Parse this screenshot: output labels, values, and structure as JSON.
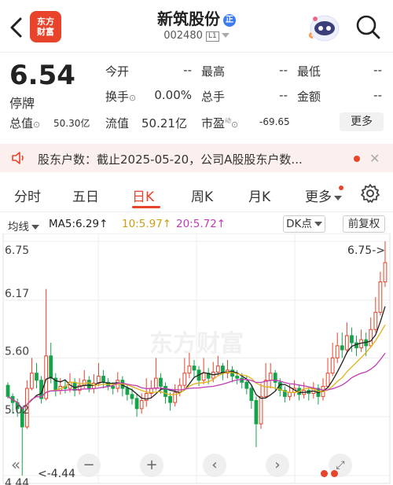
{
  "header": {
    "logo_line1": "东方",
    "logo_line2": "财富",
    "stock_name": "新筑股份",
    "name_badge": "正",
    "stock_code": "002480",
    "level": "L1"
  },
  "quote": {
    "price": "6.54",
    "status": "停牌",
    "rows": [
      {
        "label": "今开",
        "value": "--"
      },
      {
        "label": "最高",
        "value": "--"
      },
      {
        "label": "最低",
        "value": "--"
      },
      {
        "label": "换手",
        "value": "0.00%"
      },
      {
        "label": "总手",
        "value": "--"
      },
      {
        "label": "金额",
        "value": "--"
      }
    ],
    "total_cap_label": "总值",
    "total_cap": "50.30亿",
    "float_cap_label": "流值",
    "float_cap": "50.21亿",
    "pe_label": "市盈",
    "pe_sup": "动",
    "pe_value": "-69.65",
    "more": "更多"
  },
  "notice": {
    "text": "股东户数：截止2025-05-20，公司A股股东户数..."
  },
  "tabs": [
    {
      "label": "分时"
    },
    {
      "label": "五日"
    },
    {
      "label": "日K"
    },
    {
      "label": "周K"
    },
    {
      "label": "月K"
    },
    {
      "label": "更多"
    }
  ],
  "indicator": {
    "label": "均线",
    "ma5": "MA5:6.29",
    "ma10": "10:5.97",
    "ma20": "20:5.72",
    "arrow": "↑",
    "dk": "DK点",
    "adjust": "前复权"
  },
  "colors": {
    "up": "#e8432b",
    "down": "#14a34a",
    "ma5": "#222222",
    "ma10": "#e0b21a",
    "ma20": "#c23bb5"
  },
  "chart_data": {
    "type": "candlestick",
    "y_axis_ticks": [
      "6.75",
      "6.17",
      "5.60",
      "5.02",
      "4.44"
    ],
    "ylim": [
      4.44,
      6.75
    ],
    "max_label": "6.75->",
    "min_label": "<-4.44",
    "watermark": "东方财富",
    "candles": [
      [
        5.33,
        5.22,
        5.36,
        5.2
      ],
      [
        5.22,
        5.16,
        5.25,
        5.05
      ],
      [
        5.16,
        5.1,
        5.2,
        5.02
      ],
      [
        5.1,
        4.92,
        5.12,
        4.44
      ],
      [
        4.92,
        5.3,
        5.38,
        4.9
      ],
      [
        5.3,
        5.45,
        5.6,
        5.28
      ],
      [
        5.45,
        5.38,
        5.55,
        5.3
      ],
      [
        5.38,
        5.2,
        5.42,
        5.15
      ],
      [
        5.2,
        5.62,
        6.28,
        5.18
      ],
      [
        5.62,
        5.4,
        5.75,
        5.35
      ],
      [
        5.4,
        5.28,
        5.45,
        5.22
      ],
      [
        5.28,
        5.32,
        5.4,
        5.24
      ],
      [
        5.32,
        5.3,
        5.38,
        5.25
      ],
      [
        5.3,
        5.36,
        5.45,
        5.26
      ],
      [
        5.36,
        5.28,
        5.4,
        5.22
      ],
      [
        5.28,
        5.33,
        5.4,
        5.24
      ],
      [
        5.33,
        5.38,
        5.48,
        5.3
      ],
      [
        5.38,
        5.3,
        5.42,
        5.26
      ],
      [
        5.3,
        5.35,
        5.44,
        5.25
      ],
      [
        5.35,
        5.42,
        5.55,
        5.32
      ],
      [
        5.42,
        5.36,
        5.48,
        5.3
      ],
      [
        5.36,
        5.32,
        5.4,
        5.28
      ],
      [
        5.32,
        5.3,
        5.36,
        5.24
      ],
      [
        5.3,
        5.38,
        5.46,
        5.26
      ],
      [
        5.38,
        5.3,
        5.42,
        5.22
      ],
      [
        5.3,
        5.24,
        5.34,
        5.18
      ],
      [
        5.24,
        5.2,
        5.3,
        5.14
      ],
      [
        5.2,
        5.1,
        5.24,
        5.02
      ],
      [
        5.1,
        5.18,
        5.25,
        5.05
      ],
      [
        5.18,
        5.25,
        5.4,
        5.12
      ],
      [
        5.25,
        5.3,
        5.38,
        5.2
      ],
      [
        5.3,
        5.4,
        5.6,
        5.28
      ],
      [
        5.4,
        5.32,
        5.45,
        5.25
      ],
      [
        5.32,
        5.22,
        5.36,
        5.15
      ],
      [
        5.22,
        5.16,
        5.26,
        5.08
      ],
      [
        5.16,
        5.26,
        5.34,
        5.12
      ],
      [
        5.26,
        5.33,
        5.4,
        5.22
      ],
      [
        5.33,
        5.45,
        5.6,
        5.3
      ],
      [
        5.45,
        5.52,
        5.65,
        5.4
      ],
      [
        5.52,
        5.48,
        5.58,
        5.4
      ],
      [
        5.48,
        5.38,
        5.52,
        5.32
      ],
      [
        5.38,
        5.45,
        5.6,
        5.34
      ],
      [
        5.45,
        5.4,
        5.5,
        5.34
      ],
      [
        5.4,
        5.46,
        5.56,
        5.36
      ],
      [
        5.46,
        5.52,
        5.62,
        5.42
      ],
      [
        5.52,
        5.45,
        5.55,
        5.38
      ],
      [
        5.45,
        5.48,
        5.58,
        5.4
      ],
      [
        5.48,
        5.42,
        5.52,
        5.36
      ],
      [
        5.42,
        5.4,
        5.48,
        5.34
      ],
      [
        5.4,
        5.36,
        5.45,
        5.3
      ],
      [
        5.36,
        5.3,
        5.42,
        5.24
      ],
      [
        5.3,
        5.18,
        5.34,
        5.1
      ],
      [
        5.18,
        4.95,
        5.22,
        4.72
      ],
      [
        4.95,
        5.22,
        5.35,
        4.9
      ],
      [
        5.22,
        5.38,
        5.55,
        5.2
      ],
      [
        5.38,
        5.45,
        5.55,
        5.3
      ],
      [
        5.45,
        5.36,
        5.48,
        5.28
      ],
      [
        5.36,
        5.28,
        5.4,
        5.22
      ],
      [
        5.28,
        5.22,
        5.32,
        5.16
      ],
      [
        5.22,
        5.26,
        5.34,
        5.18
      ],
      [
        5.26,
        5.3,
        5.38,
        5.22
      ],
      [
        5.3,
        5.24,
        5.34,
        5.18
      ],
      [
        5.24,
        5.28,
        5.36,
        5.2
      ],
      [
        5.28,
        5.25,
        5.32,
        5.18
      ],
      [
        5.25,
        5.3,
        5.36,
        5.2
      ],
      [
        5.3,
        5.22,
        5.34,
        5.14
      ],
      [
        5.22,
        5.32,
        5.4,
        5.18
      ],
      [
        5.32,
        5.45,
        5.6,
        5.3
      ],
      [
        5.45,
        5.6,
        5.75,
        5.42
      ],
      [
        5.6,
        5.72,
        5.85,
        5.55
      ],
      [
        5.72,
        5.68,
        5.85,
        5.6
      ],
      [
        5.68,
        5.82,
        5.95,
        5.64
      ],
      [
        5.82,
        5.75,
        5.9,
        5.66
      ],
      [
        5.75,
        5.7,
        5.82,
        5.62
      ],
      [
        5.7,
        5.78,
        5.88,
        5.66
      ],
      [
        5.78,
        5.72,
        5.85,
        5.62
      ],
      [
        5.72,
        5.88,
        6.0,
        5.7
      ],
      [
        5.88,
        6.05,
        6.2,
        5.85
      ],
      [
        6.05,
        6.35,
        6.45,
        6.02
      ],
      [
        6.35,
        6.54,
        6.75,
        6.3
      ]
    ]
  }
}
